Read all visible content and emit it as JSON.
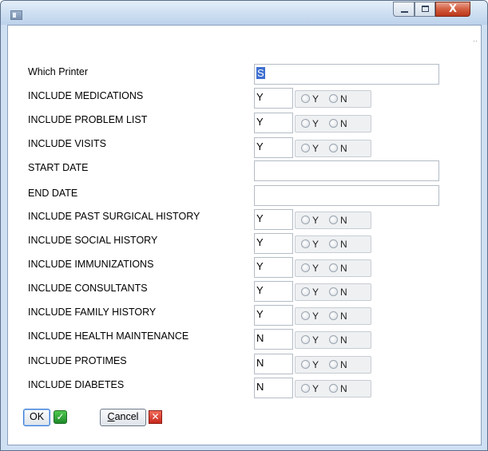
{
  "window": {
    "title": "",
    "controls": {
      "minimize": "–",
      "maximize": "□",
      "close": "X"
    }
  },
  "form": {
    "grip": "··",
    "printer": {
      "label": "Which Printer",
      "value": "S"
    },
    "rows": [
      {
        "label": "INCLUDE MEDICATIONS",
        "value": "Y",
        "opt_y": "Y",
        "opt_n": "N"
      },
      {
        "label": "INCLUDE PROBLEM LIST",
        "value": "Y",
        "opt_y": "Y",
        "opt_n": "N"
      },
      {
        "label": "INCLUDE VISITS",
        "value": "Y",
        "opt_y": "Y",
        "opt_n": "N"
      },
      {
        "label": "START DATE",
        "value": ""
      },
      {
        "label": "END DATE",
        "value": ""
      },
      {
        "label": "INCLUDE PAST SURGICAL HISTORY",
        "value": "Y",
        "opt_y": "Y",
        "opt_n": "N"
      },
      {
        "label": "INCLUDE SOCIAL HISTORY",
        "value": "Y",
        "opt_y": "Y",
        "opt_n": "N"
      },
      {
        "label": "INCLUDE IMMUNIZATIONS",
        "value": "Y",
        "opt_y": "Y",
        "opt_n": "N"
      },
      {
        "label": "INCLUDE CONSULTANTS",
        "value": "Y",
        "opt_y": "Y",
        "opt_n": "N"
      },
      {
        "label": "INCLUDE FAMILY HISTORY",
        "value": "Y",
        "opt_y": "Y",
        "opt_n": "N"
      },
      {
        "label": "INCLUDE HEALTH MAINTENANCE",
        "value": "N",
        "opt_y": "Y",
        "opt_n": "N"
      },
      {
        "label": "INCLUDE PROTIMES",
        "value": "N",
        "opt_y": "Y",
        "opt_n": "N"
      },
      {
        "label": "INCLUDE DIABETES",
        "value": "N",
        "opt_y": "Y",
        "opt_n": "N"
      }
    ]
  },
  "buttons": {
    "ok": "OK",
    "cancel_accel": "C",
    "cancel_rest": "ancel",
    "ok_icon": "✓",
    "cancel_icon": "✕"
  },
  "colors": {
    "accent_green": "#2aa136",
    "accent_red": "#d8332a",
    "selection": "#3d6fd0"
  }
}
